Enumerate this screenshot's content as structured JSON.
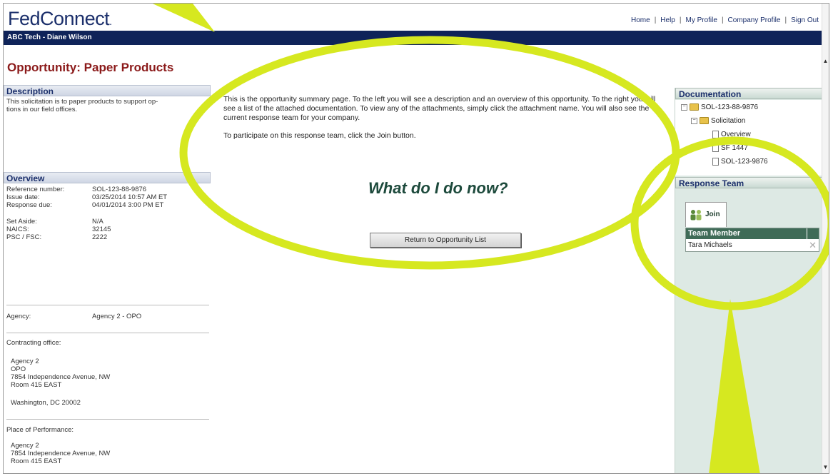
{
  "app": {
    "logo": "FedConnect",
    "logo_dot": "."
  },
  "top_links": [
    "Home",
    "Help",
    "My Profile",
    "Company Profile",
    "Sign Out"
  ],
  "user_bar": "ABC Tech - Diane Wilson",
  "page_title": "Opportunity:  Paper Products",
  "description": {
    "heading": "Description",
    "text_line1": "This solicitation is to paper products to support op-",
    "text_line2": "tions in our field offices."
  },
  "overview": {
    "heading": "Overview",
    "reference_label": "Reference number:",
    "reference_value": "SOL-123-88-9876",
    "issue_label": "Issue date:",
    "issue_value": "03/25/2014  10:57 AM  ET",
    "response_label": "Response due:",
    "response_value": "04/01/2014 3:00 PM  ET",
    "setaside_label": "Set Aside:",
    "setaside_value": "N/A",
    "naics_label": "NAICS:",
    "naics_value": "32145",
    "psc_label": "PSC / FSC:",
    "psc_value": "2222",
    "agency_label": "Agency:",
    "agency_value": "Agency 2 - OPO",
    "contracting_label": "Contracting office:",
    "contracting_lines": [
      "Agency 2",
      "OPO",
      "7854 Independence Avenue, NW",
      "Room 415 EAST",
      "Washington, DC 20002"
    ],
    "place_label": "Place of Performance:",
    "place_lines": [
      "Agency 2",
      "7854 Independence Avenue, NW",
      "Room 415 EAST"
    ]
  },
  "main": {
    "para1": "This is the opportunity summary page. To the left you will see a description and an overview of this opportunity. To the right you will see a list of the attached documentation. To view any of the attachments, simply click the attachment name. You will also see the current response team for your company.",
    "para2": "To participate on this response team, click the Join button.",
    "headline": "What do I do now?",
    "return_button": "Return to Opportunity List"
  },
  "documentation": {
    "heading": "Documentation",
    "root": "SOL-123-88-9876",
    "folder": "Solicitation",
    "items": [
      "Overview",
      "SF 1447",
      "SOL-123-9876"
    ]
  },
  "response_team": {
    "heading": "Response Team",
    "join_label": "Join",
    "column_header": "Team Member",
    "members": [
      "Tara Michaels"
    ]
  },
  "colors": {
    "navy": "#0f2359",
    "title_red": "#8b1a1a",
    "highlight": "#d6e820",
    "team_green": "#3f6b57"
  }
}
